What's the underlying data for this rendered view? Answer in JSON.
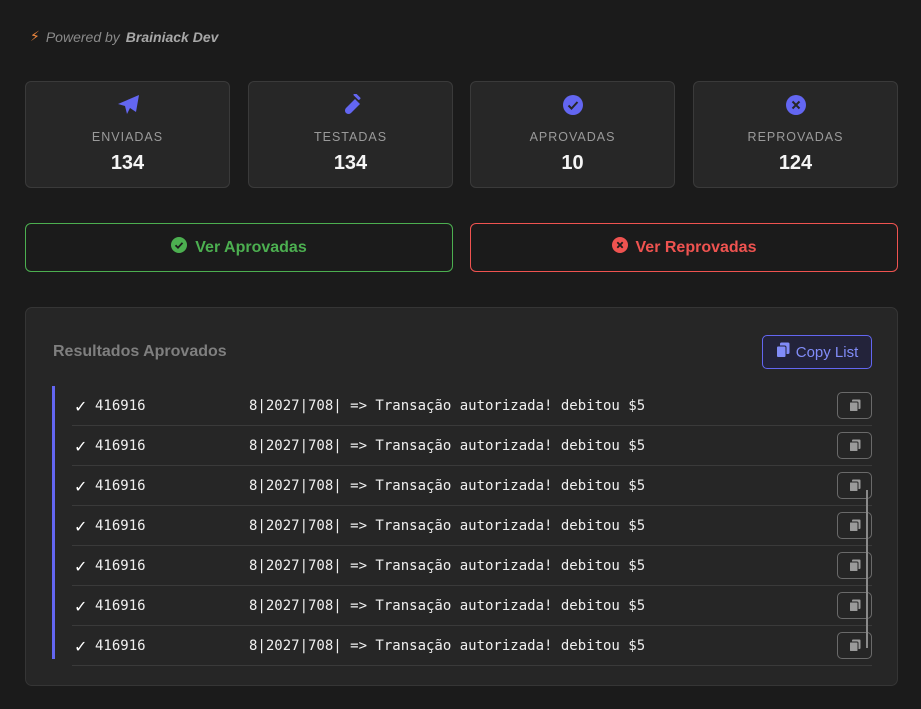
{
  "header": {
    "powered_prefix": "Powered by",
    "powered_name": "Brainiack Dev"
  },
  "stats": [
    {
      "label": "ENVIADAS",
      "value": "134",
      "icon": "paper-plane-icon"
    },
    {
      "label": "TESTADAS",
      "value": "134",
      "icon": "test-tube-icon"
    },
    {
      "label": "APROVADAS",
      "value": "10",
      "icon": "check-circle-icon"
    },
    {
      "label": "REPROVADAS",
      "value": "124",
      "icon": "x-circle-icon"
    }
  ],
  "buttons": {
    "approved": "Ver Aprovadas",
    "rejected": "Ver Reprovadas"
  },
  "results": {
    "title": "Resultados Aprovados",
    "copy_list": "Copy List",
    "rows": [
      {
        "check": "✓",
        "bin": "416916",
        "text": "8|2027|708| => Transação autorizada! debitou $5"
      },
      {
        "check": "✓",
        "bin": "416916",
        "text": "8|2027|708| => Transação autorizada! debitou $5"
      },
      {
        "check": "✓",
        "bin": "416916",
        "text": "8|2027|708| => Transação autorizada! debitou $5"
      },
      {
        "check": "✓",
        "bin": "416916",
        "text": "8|2027|708| => Transação autorizada! debitou $5"
      },
      {
        "check": "✓",
        "bin": "416916",
        "text": "8|2027|708| => Transação autorizada! debitou $5"
      },
      {
        "check": "✓",
        "bin": "416916",
        "text": "8|2027|708| => Transação autorizada! debitou $5"
      },
      {
        "check": "✓",
        "bin": "416916",
        "text": "8|2027|708| => Transação autorizada! debitou $5"
      }
    ]
  },
  "colors": {
    "accent": "#6366f1",
    "approved": "#4caf50",
    "rejected": "#ef5350",
    "warn": "#f0883e"
  }
}
